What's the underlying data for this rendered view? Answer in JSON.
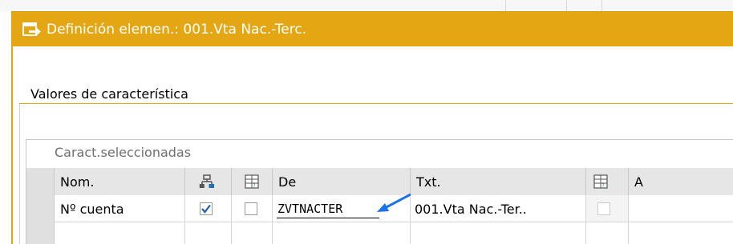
{
  "window": {
    "title": "Definición elemen.: 001.Vta Nac.-Terc.",
    "accent_color": "#e4a713",
    "title_icon": "display-change-icon"
  },
  "section": {
    "title": "Valores de característica"
  },
  "selected": {
    "title": "Caract.seleccionadas",
    "columns": [
      {
        "label": "Nom."
      },
      {
        "label": "",
        "icon": "hierarchy-icon"
      },
      {
        "label": "",
        "icon": "select-all-icon"
      },
      {
        "label": "De"
      },
      {
        "label": "Txt."
      },
      {
        "label": "",
        "icon": "select-all-icon"
      },
      {
        "label": "A"
      }
    ],
    "rows": [
      {
        "name": "Nº cuenta",
        "hierarchy_checked": true,
        "second_checked": false,
        "from": "ZVTNACTER",
        "text": "001.Vta Nac.-Ter..",
        "third_checked": false,
        "to": ""
      }
    ]
  }
}
